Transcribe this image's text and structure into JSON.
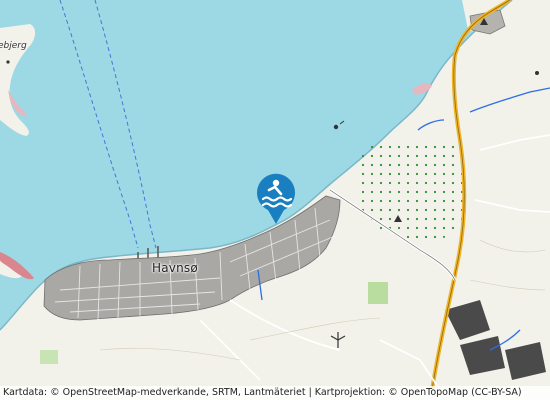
{
  "map": {
    "town_label": "Havnsø",
    "edge_label": "ebjerg",
    "marker": {
      "icon": "swimming-icon",
      "color": "#1a7fc1"
    },
    "colors": {
      "water": "#9dd8e5",
      "land": "#f2f1ea",
      "urban": "#8a8a8a",
      "forest": "#2f8f2f",
      "road": "#f0b428",
      "water_line": "#2b6ee6"
    }
  },
  "attribution": {
    "text": "Kartdata: © OpenStreetMap-medverkande, SRTM, Lantmäteriet | Kartprojektion: © OpenTopoMap (CC-BY-SA)"
  }
}
